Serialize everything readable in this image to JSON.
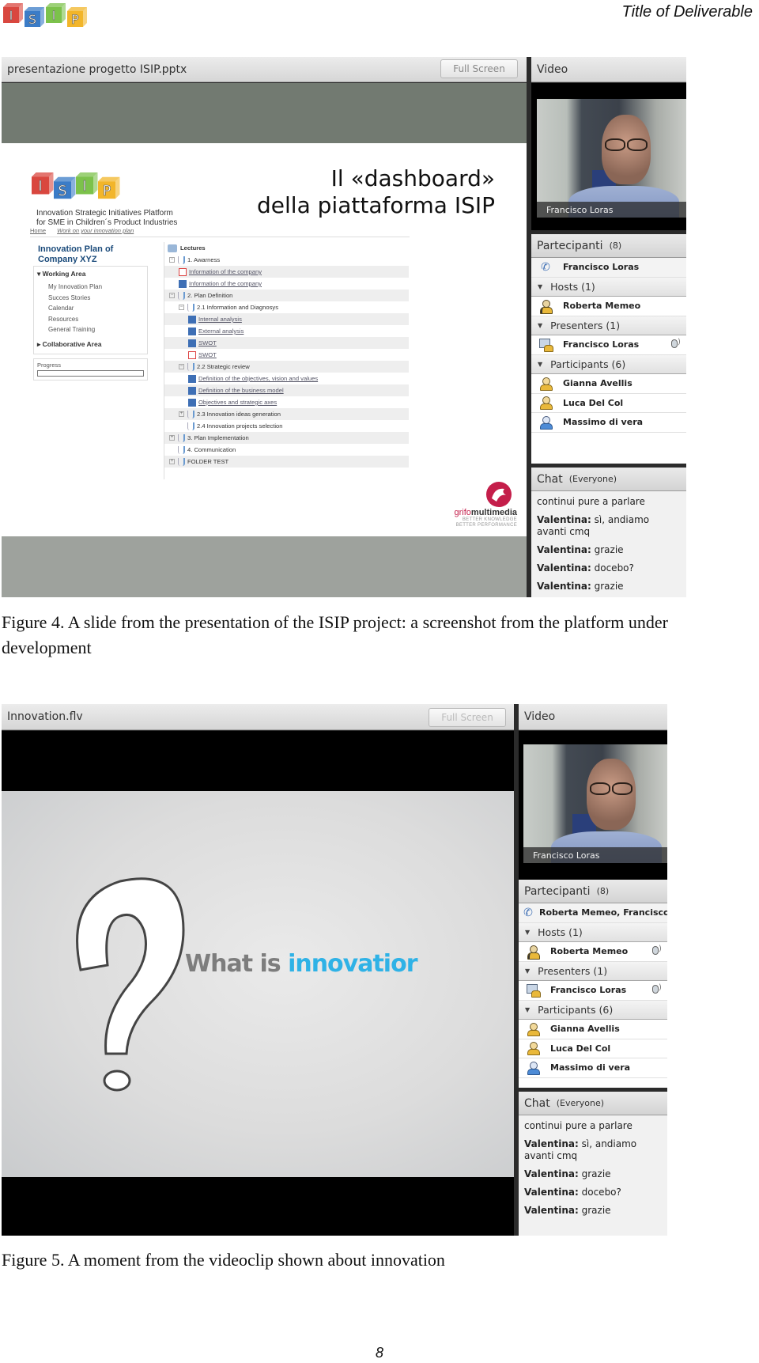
{
  "page": {
    "logo_letters": [
      "I",
      "S",
      "I",
      "P"
    ],
    "logo_colors": [
      "#d9473f",
      "#3b7cc7",
      "#7cc24b",
      "#f2b52a"
    ],
    "header_title": "Title of Deliverable",
    "page_number": "8"
  },
  "figure4": {
    "caption": "Figure 4. A slide from the presentation of the ISIP project: a screenshot from the platform under development",
    "share_pod": {
      "title": "presentazione progetto ISIP.pptx",
      "full_screen_label": "Full Screen"
    },
    "slide": {
      "title_line1": "Il «dashboard»",
      "title_line2": "della piattaforma ISIP",
      "isip_tagline_line1": "Innovation Strategic Initiatives Platform",
      "isip_tagline_line2": "for SME in Children´s Product Industries",
      "breadcrumb": [
        "Home",
        "Work on your innovation plan"
      ],
      "plan_title_line1": "Innovation Plan of",
      "plan_title_line2": "Company XYZ",
      "working_area": {
        "header": "Working Area",
        "items": [
          "My Innovation Plan",
          "Succes Stories",
          "Calendar",
          "Resources",
          "General Training"
        ],
        "collaborative": "Collaborative Area"
      },
      "progress_label": "Progress",
      "progress_value": 0,
      "lectures": {
        "header": "Lectures",
        "rows": [
          {
            "level": 0,
            "type": "folder",
            "expander": "⊟",
            "label": "1. Awarness"
          },
          {
            "level": 1,
            "type": "doc-red",
            "label": "Information of the company"
          },
          {
            "level": 1,
            "type": "doc-blue",
            "label": "Information of the company"
          },
          {
            "level": 0,
            "type": "folder",
            "expander": "⊟",
            "label": "2. Plan Definition"
          },
          {
            "level": 1,
            "type": "folder",
            "expander": "⊟",
            "label": "2.1 Information and Diagnosys"
          },
          {
            "level": 2,
            "type": "doc-blue",
            "label": "Internal analysis"
          },
          {
            "level": 2,
            "type": "doc-blue",
            "label": "External analysis"
          },
          {
            "level": 2,
            "type": "doc-blue",
            "label": "SWOT"
          },
          {
            "level": 2,
            "type": "doc-red",
            "label": "SWOT"
          },
          {
            "level": 1,
            "type": "folder",
            "expander": "⊟",
            "label": "2.2 Strategic review"
          },
          {
            "level": 2,
            "type": "doc-blue",
            "label": "Definition of the objectives, vision and values"
          },
          {
            "level": 2,
            "type": "doc-blue",
            "label": "Definition of the business model"
          },
          {
            "level": 2,
            "type": "doc-blue",
            "label": "Objectives and strategic axes"
          },
          {
            "level": 1,
            "type": "folder",
            "expander": "⊞",
            "label": "2.3 Innovation ideas generation"
          },
          {
            "level": 1,
            "type": "folder",
            "expander": "",
            "label": "2.4 Innovation projects selection"
          },
          {
            "level": 0,
            "type": "folder",
            "expander": "⊞",
            "label": "3. Plan Implementation"
          },
          {
            "level": 0,
            "type": "folder",
            "expander": "",
            "label": "4. Communication"
          },
          {
            "level": 0,
            "type": "folder",
            "expander": "⊞",
            "label": "FOLDER TEST"
          }
        ]
      },
      "grifo": {
        "name_light": "grifo",
        "name_bold": "multimedia",
        "tagline1": "BETTER KNOWLEDGE",
        "tagline2": "BETTER PERFORMANCE"
      }
    },
    "video_pod": {
      "title": "Video",
      "camera_label": "Francisco Loras"
    },
    "participants_pod": {
      "title": "Partecipanti",
      "count": "(8)",
      "phone_row": "Francisco Loras",
      "rows": [
        {
          "kind": "group",
          "label": "Hosts (1)"
        },
        {
          "kind": "host",
          "label": "Roberta Memeo",
          "mic": false
        },
        {
          "kind": "group",
          "label": "Presenters (1)"
        },
        {
          "kind": "presenter",
          "label": "Francisco Loras",
          "mic": true
        },
        {
          "kind": "group",
          "label": "Participants (6)"
        },
        {
          "kind": "participant",
          "label": "Gianna Avellis",
          "color": "yellow"
        },
        {
          "kind": "participant",
          "label": "Luca Del Col",
          "color": "yellow"
        },
        {
          "kind": "participant",
          "label": "Massimo di vera",
          "color": "blue"
        }
      ]
    },
    "chat_pod": {
      "title": "Chat",
      "scope": "(Everyone)",
      "messages": [
        {
          "sender": "",
          "text": "continui pure a parlare"
        },
        {
          "sender": "Valentina:",
          "text": " sì, andiamo avanti cmq"
        },
        {
          "sender": "Valentina:",
          "text": " grazie"
        },
        {
          "sender": "Valentina:",
          "text": " docebo?"
        },
        {
          "sender": "Valentina:",
          "text": " grazie"
        }
      ]
    }
  },
  "figure5": {
    "caption": "Figure 5. A moment from the videoclip shown about innovation",
    "share_pod": {
      "title": "Innovation.flv",
      "full_screen_label": "Full Screen"
    },
    "clip": {
      "text_gray": "What is ",
      "text_blue": "innovatior",
      "text_blue_color": "#2fb2e6"
    },
    "video_pod": {
      "title": "Video",
      "camera_label": "Francisco Loras"
    },
    "participants_pod": {
      "title": "Partecipanti",
      "count": "(8)",
      "phone_row": "Roberta Memeo, Francisco L...",
      "rows": [
        {
          "kind": "group",
          "label": "Hosts (1)"
        },
        {
          "kind": "host",
          "label": "Roberta Memeo",
          "mic": true
        },
        {
          "kind": "group",
          "label": "Presenters (1)"
        },
        {
          "kind": "presenter",
          "label": "Francisco Loras",
          "mic": true
        },
        {
          "kind": "group",
          "label": "Participants (6)"
        },
        {
          "kind": "participant",
          "label": "Gianna Avellis",
          "color": "yellow"
        },
        {
          "kind": "participant",
          "label": "Luca Del Col",
          "color": "yellow"
        },
        {
          "kind": "participant",
          "label": "Massimo di vera",
          "color": "blue"
        }
      ]
    },
    "chat_pod": {
      "title": "Chat",
      "scope": "(Everyone)",
      "messages": [
        {
          "sender": "",
          "text": "continui pure a parlare"
        },
        {
          "sender": "Valentina:",
          "text": " sì, andiamo avanti cmq"
        },
        {
          "sender": "Valentina:",
          "text": " grazie"
        },
        {
          "sender": "Valentina:",
          "text": " docebo?"
        },
        {
          "sender": "Valentina:",
          "text": " grazie"
        }
      ]
    }
  }
}
